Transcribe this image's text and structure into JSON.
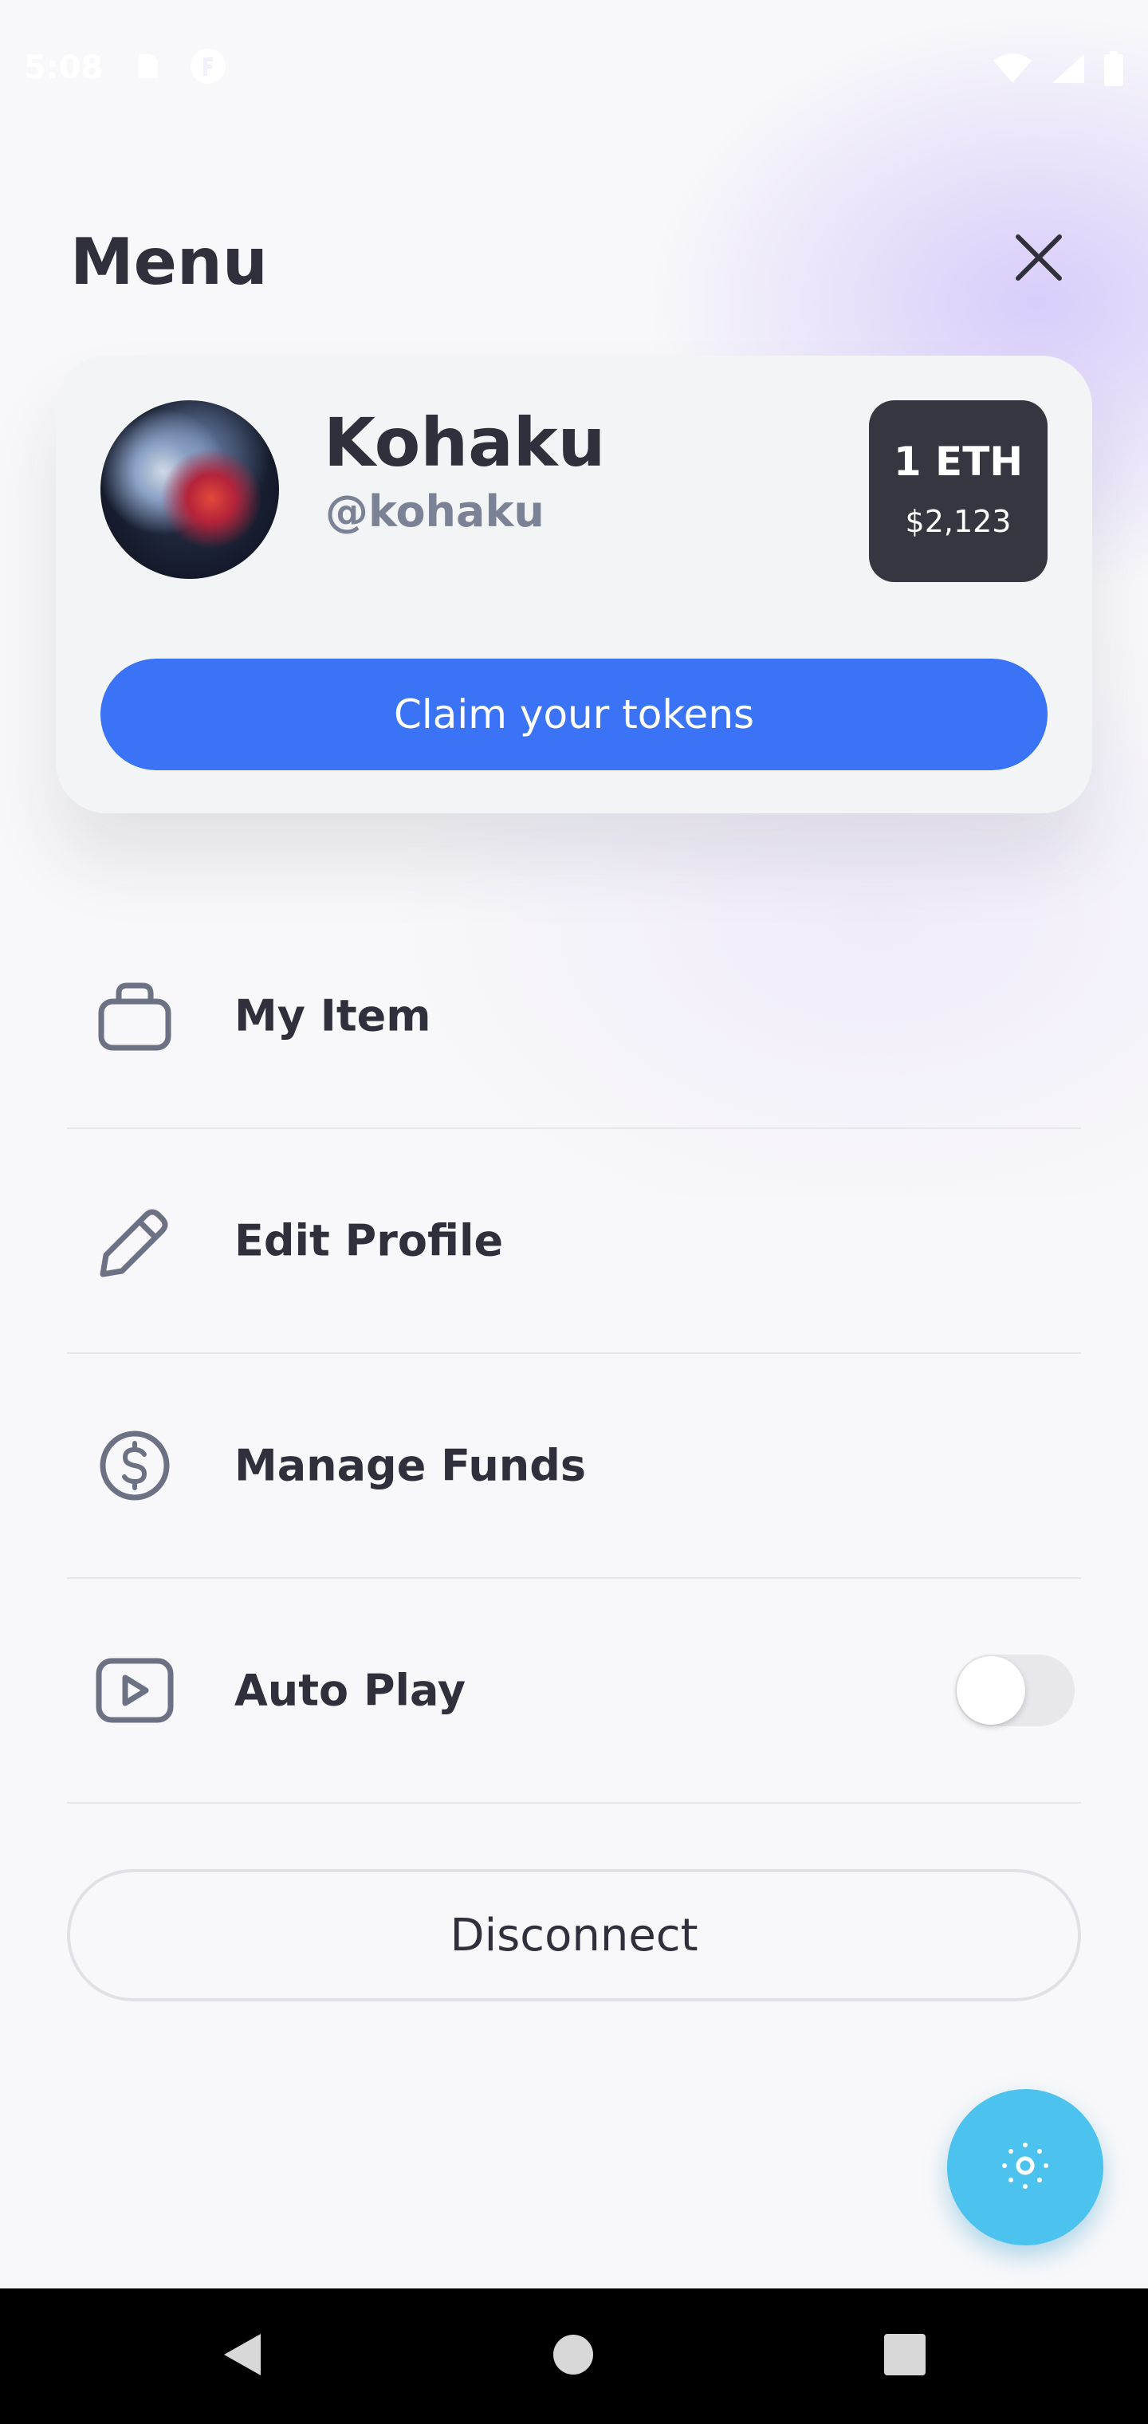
{
  "status_bar": {
    "time": "5:08",
    "icons": [
      "sd-card-icon",
      "app-notification-icon",
      "wifi-icon",
      "signal-icon",
      "battery-icon"
    ]
  },
  "header": {
    "title": "Menu",
    "close_icon": "close-icon"
  },
  "profile": {
    "name": "Kohaku",
    "handle": "@kohaku",
    "balance_amount": "1 ETH",
    "balance_usd": "$2,123",
    "claim_label": "Claim your tokens"
  },
  "menu_items": [
    {
      "label": "My Item",
      "icon": "bag-icon"
    },
    {
      "label": "Edit Profile",
      "icon": "pencil-icon"
    },
    {
      "label": "Manage Funds",
      "icon": "dollar-icon"
    },
    {
      "label": "Auto Play",
      "icon": "play-icon",
      "toggle": false
    }
  ],
  "disconnect_label": "Disconnect",
  "fab_icon": "settings-sun-icon",
  "colors": {
    "accent": "#3b73f7",
    "text_dark": "#30303d",
    "text_muted": "#7b8296",
    "eth_box": "#353640",
    "fab": "#4cc3ee",
    "card": "#f3f4f6"
  },
  "nav_bar": [
    "back-icon",
    "home-icon",
    "recents-icon"
  ]
}
